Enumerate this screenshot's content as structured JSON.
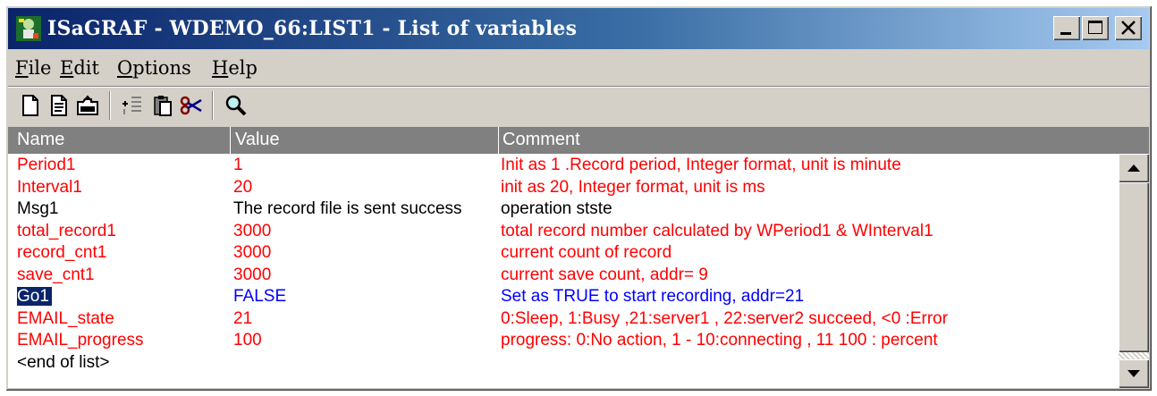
{
  "window": {
    "title": "ISaGRAF - WDEMO_66:LIST1 - List of variables",
    "app_icon": "isagraf-app-icon",
    "controls": [
      "minimize-icon",
      "maximize-icon",
      "close-icon"
    ]
  },
  "menu": {
    "items": [
      {
        "label": "File",
        "accel": "F",
        "rest": "ile"
      },
      {
        "label": "Edit",
        "accel": "E",
        "rest": "dit"
      },
      {
        "label": "Options",
        "accel": "O",
        "rest": "ptions"
      },
      {
        "label": "Help",
        "accel": "H",
        "rest": "elp"
      }
    ]
  },
  "toolbar": {
    "icons": [
      "new-file-icon",
      "edit-file-icon",
      "open-folder-icon",
      "insert-row-icon",
      "paste-icon",
      "cut-icon",
      "find-icon"
    ]
  },
  "table": {
    "columns": [
      "Name",
      "Value",
      "Comment"
    ],
    "selected_row": 6,
    "rows": [
      {
        "name": "Period1",
        "value": "1",
        "comment": "Init as 1 .Record period, Integer format, unit is minute",
        "color": "#ff0000"
      },
      {
        "name": "Interval1",
        "value": "20",
        "comment": "init as 20, Integer format, unit is ms",
        "color": "#ff0000"
      },
      {
        "name": "Msg1",
        "value": "The record file is sent success",
        "comment": "operation stste",
        "color": "#000000"
      },
      {
        "name": "total_record1",
        "value": "3000",
        "comment": "total record number calculated by WPeriod1 & WInterval1",
        "color": "#ff0000"
      },
      {
        "name": "record_cnt1",
        "value": "3000",
        "comment": "current count of record",
        "color": "#ff0000"
      },
      {
        "name": "save_cnt1",
        "value": "3000",
        "comment": "current save count, addr= 9",
        "color": "#ff0000"
      },
      {
        "name": "Go1",
        "value": "FALSE",
        "comment": "Set as TRUE to start recording, addr=21",
        "color": "#0000ff"
      },
      {
        "name": "EMAIL_state",
        "value": "21",
        "comment": "0:Sleep, 1:Busy ,21:server1 , 22:server2 succeed, <0 :Error",
        "color": "#ff0000"
      },
      {
        "name": "EMAIL_progress",
        "value": "100",
        "comment": "progress: 0:No action, 1 - 10:connecting , 11  100 : percent",
        "color": "#ff0000"
      },
      {
        "name": "<end of list>",
        "value": "",
        "comment": "",
        "color": "#000000"
      }
    ]
  },
  "scrollbar": {
    "up_icon": "scroll-up-arrow-icon",
    "down_icon": "scroll-down-arrow-icon"
  },
  "colors": {
    "title_gradient_start": "#0a246a",
    "title_gradient_end": "#a6caf0",
    "header_bg": "#808080",
    "selection": "#0a246a"
  }
}
